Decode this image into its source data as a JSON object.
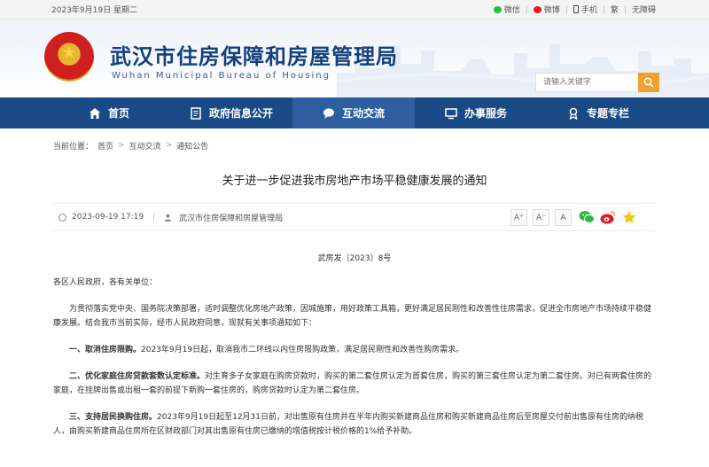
{
  "topbar": {
    "date": "2023年9月19日 星期二",
    "links": [
      "微信",
      "微博",
      "手机",
      "繁",
      "无障碍"
    ]
  },
  "header": {
    "title_cn": "武汉市住房保障和房屋管理局",
    "title_en": "Wuhan Municipal Bureau of Housing",
    "search_placeholder": "请输入关键字"
  },
  "nav": {
    "items": [
      {
        "label": "首页",
        "icon": "home-icon"
      },
      {
        "label": "政府信息公开",
        "icon": "document-icon"
      },
      {
        "label": "互动交流",
        "icon": "chat-icon"
      },
      {
        "label": "办事服务",
        "icon": "monitor-icon"
      },
      {
        "label": "专题专栏",
        "icon": "ribbon-icon"
      }
    ],
    "active_index": 2
  },
  "breadcrumb": {
    "prefix": "当前位置：",
    "items": [
      "首页",
      "互动交流",
      "通知公告"
    ]
  },
  "article": {
    "title": "关于进一步促进我市房地产市场平稳健康发展的通知",
    "datetime": "2023-09-19 17:19",
    "source": "武汉市住房保障和房屋管理局",
    "font_sizes": [
      "A⁺",
      "A⁻",
      "A"
    ],
    "doc_no": "武房发〔2023〕8号",
    "salutation": "各区人民政府，各有关单位：",
    "intro": "为贯彻落实党中央、国务院决策部署，适时调整优化房地产政策，因城施策，用好政策工具箱，更好满足居民刚性和改善性住房需求，促进全市房地产市场持续平稳健康发展。结合我市当前实际，经市人民政府同意，现就有关事项通知如下：",
    "sections": [
      {
        "head": "一、取消住房限购。",
        "text": "2023年9月19日起，取消我市二环线以内住房限购政策，满足居民刚性和改善性购房需求。"
      },
      {
        "head": "二、优化家庭住房贷款套数认定标准。",
        "text": "对生育多子女家庭在购房贷款时，购买的第二套住房认定为首套住房，购买的第三套住房认定为第二套住房。对已有两套住房的家庭，在挂牌出售或出租一套的前提下新购一套住房的，购房贷款时认定为第二套住房。"
      },
      {
        "head": "三、支持居民换购住房。",
        "text": "2023年9月19日起至12月31日前，对出售原有住房并在半年内购买新建商品住房和购买新建商品住房后至房屋交付前出售原有住房的纳税人，由购买新建商品住房所在区财政部门对其出售原有住房已缴纳的增值税按计税价格的1%给予补助。"
      }
    ]
  },
  "colors": {
    "nav_bg": "#1a4a86",
    "nav_active": "#2d5fa0",
    "title_blue": "#15407e",
    "search_btn": "#f2a02c"
  }
}
